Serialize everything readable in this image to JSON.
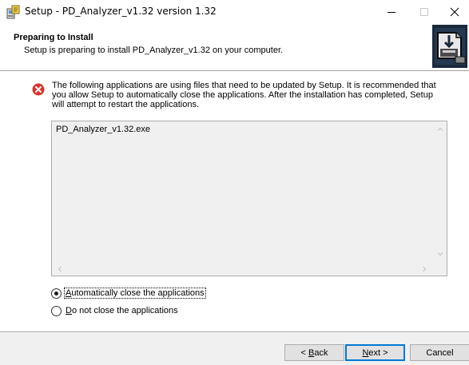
{
  "window": {
    "title": "Setup - PD_Analyzer_v1.32 version 1.32"
  },
  "header": {
    "title": "Preparing to Install",
    "subtitle": "Setup is preparing to install PD_Analyzer_v1.32 on your computer."
  },
  "message": "The following applications are using files that need to be updated by Setup. It is recommended that you allow Setup to automatically close the applications. After the installation has completed, Setup will attempt to restart the applications.",
  "applications": [
    "PD_Analyzer_v1.32.exe"
  ],
  "options": {
    "auto_close": {
      "accel": "A",
      "rest": "utomatically close the applications",
      "selected": true
    },
    "do_not_close": {
      "accel": "D",
      "rest": "o not close the applications",
      "selected": false
    }
  },
  "buttons": {
    "back": {
      "prefix": "< ",
      "accel": "B",
      "rest": "ack"
    },
    "next": {
      "accel": "N",
      "rest": "ext >"
    },
    "cancel": "Cancel"
  },
  "icons": {
    "app": "setup-app-icon",
    "error": "error-icon",
    "wizard": "wizard-image"
  },
  "colors": {
    "error_red": "#d9352b",
    "default_button_border": "#0078d7",
    "footer_bg": "#f0f0f0"
  }
}
